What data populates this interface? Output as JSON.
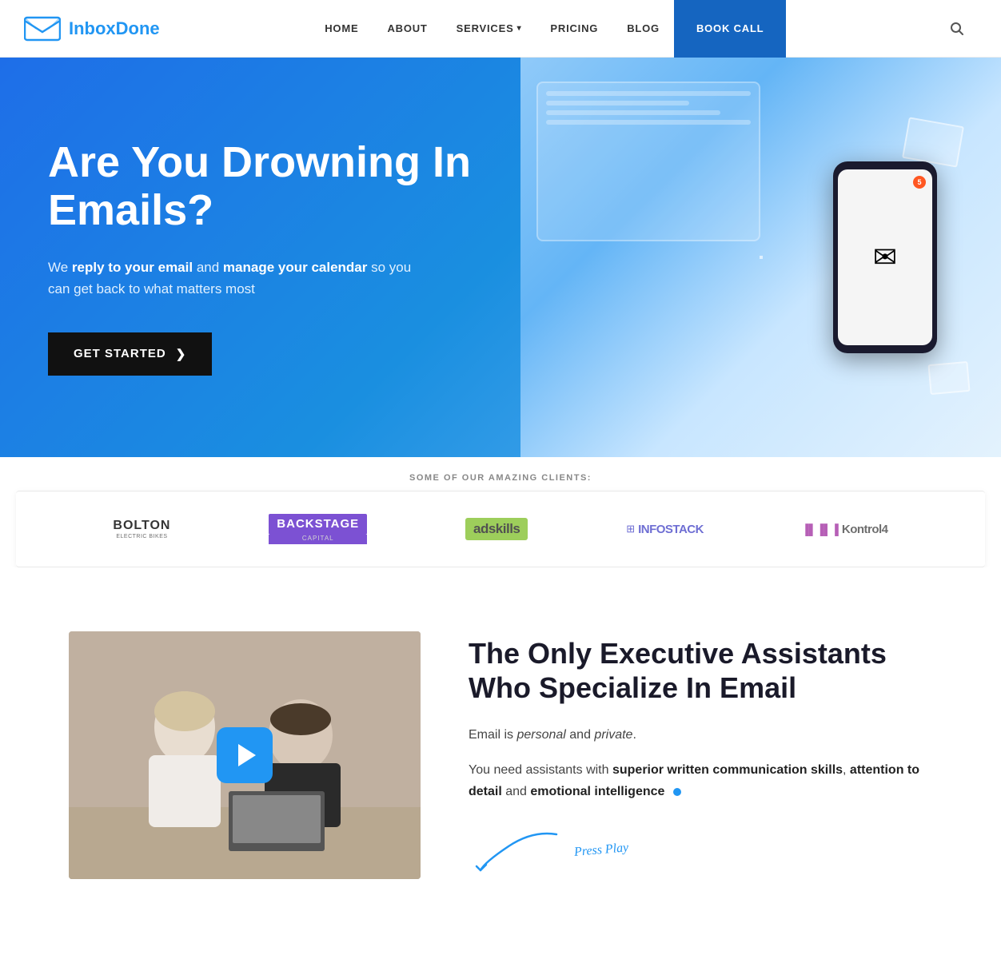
{
  "brand": {
    "name_part1": "Inbox",
    "name_part2": "Done",
    "logo_alt": "InboxDone logo"
  },
  "navbar": {
    "links": [
      {
        "label": "HOME",
        "href": "#"
      },
      {
        "label": "ABOUT",
        "href": "#"
      },
      {
        "label": "SERVICES",
        "href": "#",
        "has_dropdown": true
      },
      {
        "label": "PRICING",
        "href": "#"
      },
      {
        "label": "BLOG",
        "href": "#"
      }
    ],
    "book_call_label": "BOOK CALL",
    "search_placeholder": "Search..."
  },
  "hero": {
    "title": "Are You Drowning In Emails?",
    "subtitle_prefix": "We ",
    "subtitle_bold1": "reply to your email",
    "subtitle_middle": " and ",
    "subtitle_bold2": "manage your calendar",
    "subtitle_suffix": " so you can get back to what matters most",
    "cta_label": "GET STARTED",
    "cta_arrow": "❯"
  },
  "clients": {
    "label": "SOME OF OUR AMAZING CLIENTS:",
    "logos": [
      {
        "id": "bolton",
        "name": "BOLTON",
        "sub": "Electric Bikes"
      },
      {
        "id": "backstage",
        "name": "BACKSTAGE",
        "sub": "CAPITAL"
      },
      {
        "id": "adskills",
        "name": "adskills"
      },
      {
        "id": "infostack",
        "name": "INFOSTACK"
      },
      {
        "id": "kontrol",
        "name": "Kontrol4"
      }
    ]
  },
  "about": {
    "title": "The Only Executive Assistants Who Specialize In Email",
    "desc1_prefix": "Email is ",
    "desc1_italic1": "personal",
    "desc1_mid": " and ",
    "desc1_italic2": "private",
    "desc1_suffix": ".",
    "desc2_prefix": "You need assistants with ",
    "desc2_bold1": "superior written communication skills",
    "desc2_comma": ", ",
    "desc2_bold2": "attention to detail",
    "desc2_mid": " and ",
    "desc2_bold3": "emotional intelligence",
    "press_play_label": "Press Play"
  }
}
